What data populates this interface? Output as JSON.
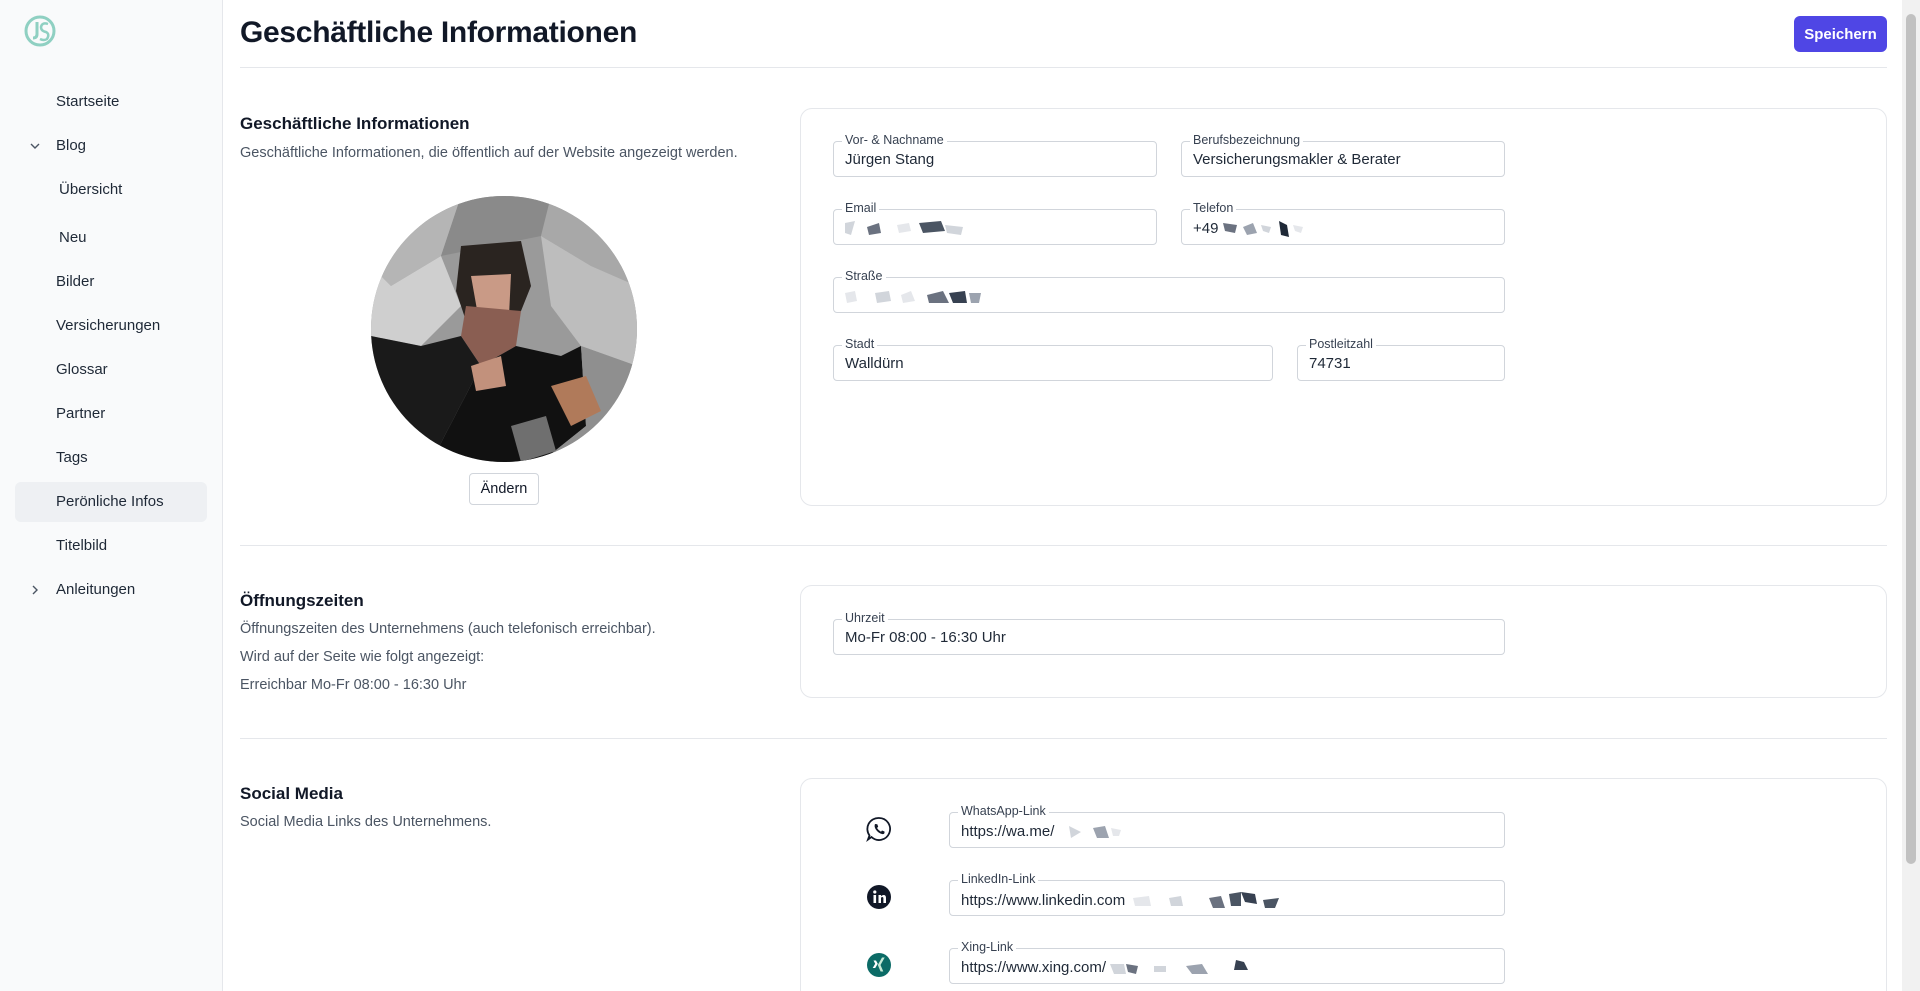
{
  "sidebar": {
    "items": [
      {
        "label": "Startseite"
      },
      {
        "label": "Blog"
      },
      {
        "label": "Übersicht"
      },
      {
        "label": "Neu"
      },
      {
        "label": "Bilder"
      },
      {
        "label": "Versicherungen"
      },
      {
        "label": "Glossar"
      },
      {
        "label": "Partner"
      },
      {
        "label": "Tags"
      },
      {
        "label": "Perönliche Infos"
      },
      {
        "label": "Titelbild"
      },
      {
        "label": "Anleitungen"
      }
    ]
  },
  "header": {
    "title": "Geschäftliche Informationen",
    "save_label": "Speichern"
  },
  "business": {
    "title": "Geschäftliche Informationen",
    "description": "Geschäftliche Informationen, die öffentlich auf der Website angezeigt werden.",
    "change_label": "Ändern",
    "fields": {
      "name": {
        "label": "Vor- & Nachname",
        "value": "Jürgen Stang"
      },
      "job": {
        "label": "Berufsbezeichnung",
        "value": "Versicherungsmakler & Berater"
      },
      "email": {
        "label": "Email",
        "value": ""
      },
      "phone": {
        "label": "Telefon",
        "value": "+49"
      },
      "street": {
        "label": "Straße",
        "value": ""
      },
      "city": {
        "label": "Stadt",
        "value": "Walldürn"
      },
      "zip": {
        "label": "Postleitzahl",
        "value": "74731"
      }
    }
  },
  "hours": {
    "title": "Öffnungszeiten",
    "description": "Öffnungszeiten des Unternehmens (auch telefonisch erreichbar).",
    "display_note": "Wird auf der Seite wie folgt angezeigt:",
    "preview": "Erreichbar Mo-Fr 08:00 - 16:30 Uhr",
    "field": {
      "label": "Uhrzeit",
      "value": "Mo-Fr 08:00 - 16:30 Uhr"
    }
  },
  "social": {
    "title": "Social Media",
    "description": "Social Media Links des Unternehmens.",
    "whatsapp": {
      "label": "WhatsApp-Link",
      "value": "https://wa.me/",
      "icon": "whatsapp-icon"
    },
    "linkedin": {
      "label": "LinkedIn-Link",
      "value": "https://www.linkedin.com",
      "icon": "linkedin-icon"
    },
    "xing": {
      "label": "Xing-Link",
      "value": "https://www.xing.com/",
      "icon": "xing-icon"
    }
  },
  "colors": {
    "accent": "#4f46e5",
    "logo": "#8fd0c2",
    "xing": "#0b6b66"
  }
}
